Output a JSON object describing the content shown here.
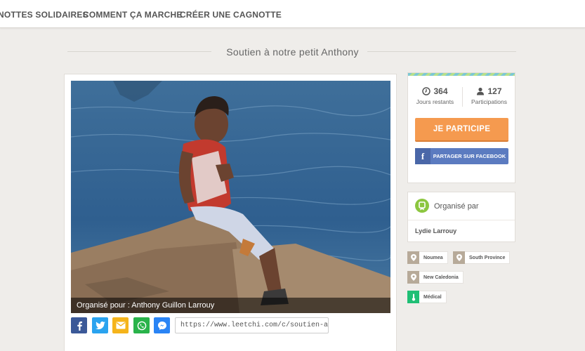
{
  "nav": {
    "items": [
      "NOTTES SOLIDAIRES",
      "COMMENT ÇA MARCHE",
      "CRÉER UNE CAGNOTTE"
    ]
  },
  "page": {
    "title": "Soutien à notre petit Anthony"
  },
  "photo": {
    "caption": "Organisé pour : Anthony Guillon Larrouy"
  },
  "share": {
    "buttons": [
      "facebook-icon",
      "twitter-icon",
      "email-icon",
      "whatsapp-icon",
      "messenger-icon"
    ],
    "url": "https://www.leetchi.com/c/soutien-a-notre-p..."
  },
  "stats": {
    "days_value": "364",
    "days_label": "Jours restants",
    "participants_value": "127",
    "participants_label": "Participations"
  },
  "actions": {
    "participate_label": "JE PARTICIPE",
    "facebook_share_label": "PARTAGER SUR FACEBOOK"
  },
  "organizer": {
    "heading": "Organisé par",
    "name": "Lydie Larrouy"
  },
  "tags": [
    "Noumea",
    "South Province",
    "New Caledonia",
    "Médical"
  ],
  "colors": {
    "accent_orange": "#f59a4f",
    "facebook_blue": "#5b7bc0",
    "organizer_green": "#8cc63f",
    "medical_green": "#1fbf75",
    "location_tan": "#b7aa99"
  }
}
